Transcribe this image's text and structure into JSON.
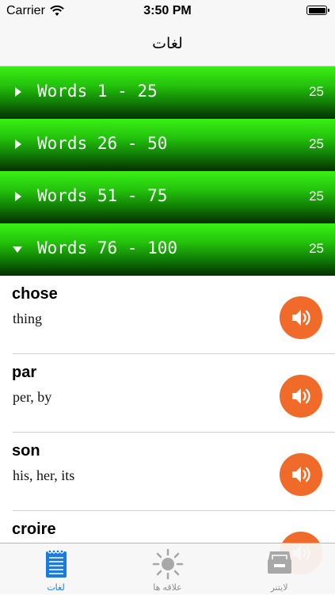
{
  "status_bar": {
    "carrier": "Carrier",
    "time": "3:50 PM"
  },
  "nav": {
    "title": "لغات"
  },
  "sections": [
    {
      "title": "Words 1 - 25",
      "count": "25",
      "expanded": false
    },
    {
      "title": "Words 26 - 50",
      "count": "25",
      "expanded": false
    },
    {
      "title": "Words 51 - 75",
      "count": "25",
      "expanded": false
    },
    {
      "title": "Words 76 - 100",
      "count": "25",
      "expanded": true
    }
  ],
  "words": [
    {
      "word": "chose",
      "translation": "thing"
    },
    {
      "word": "par",
      "translation": "per, by"
    },
    {
      "word": "son",
      "translation": "his, her, its"
    },
    {
      "word": "croire",
      "translation": ""
    }
  ],
  "tabs": [
    {
      "label": "لغات",
      "icon": "notepad-icon",
      "active": true
    },
    {
      "label": "علاقه ها",
      "icon": "sun-icon",
      "active": false
    },
    {
      "label": "لایتنر",
      "icon": "tray-icon",
      "active": false
    }
  ],
  "colors": {
    "accent": "#1a7bdc",
    "speaker": "#f06a2a",
    "section_green": "#24c40c"
  }
}
